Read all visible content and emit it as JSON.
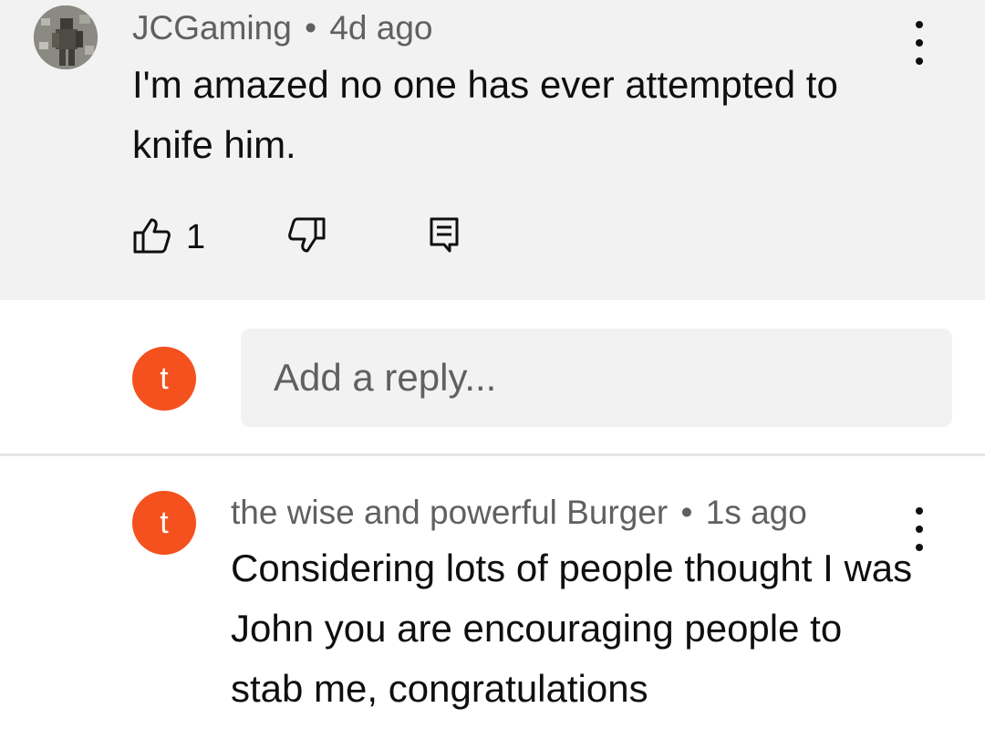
{
  "comment": {
    "author": "JCGaming",
    "separator": "•",
    "time": "4d ago",
    "text": "I'm amazed no one has ever attempted to knife him.",
    "likes": "1",
    "avatar_icon": "soldier-avatar-image",
    "icons": [
      "thumbs-up-icon",
      "thumbs-down-icon",
      "reply-icon",
      "more-vert-icon"
    ]
  },
  "reply_box": {
    "avatar_letter": "t",
    "avatar_color": "#f4511e",
    "placeholder": "Add a reply..."
  },
  "reply": {
    "avatar_letter": "t",
    "avatar_color": "#f4511e",
    "author": "the wise and powerful Burger",
    "separator": "•",
    "time": "1s ago",
    "text": "Considering lots of people thought I was John you are encouraging people to stab me, congratulations"
  }
}
